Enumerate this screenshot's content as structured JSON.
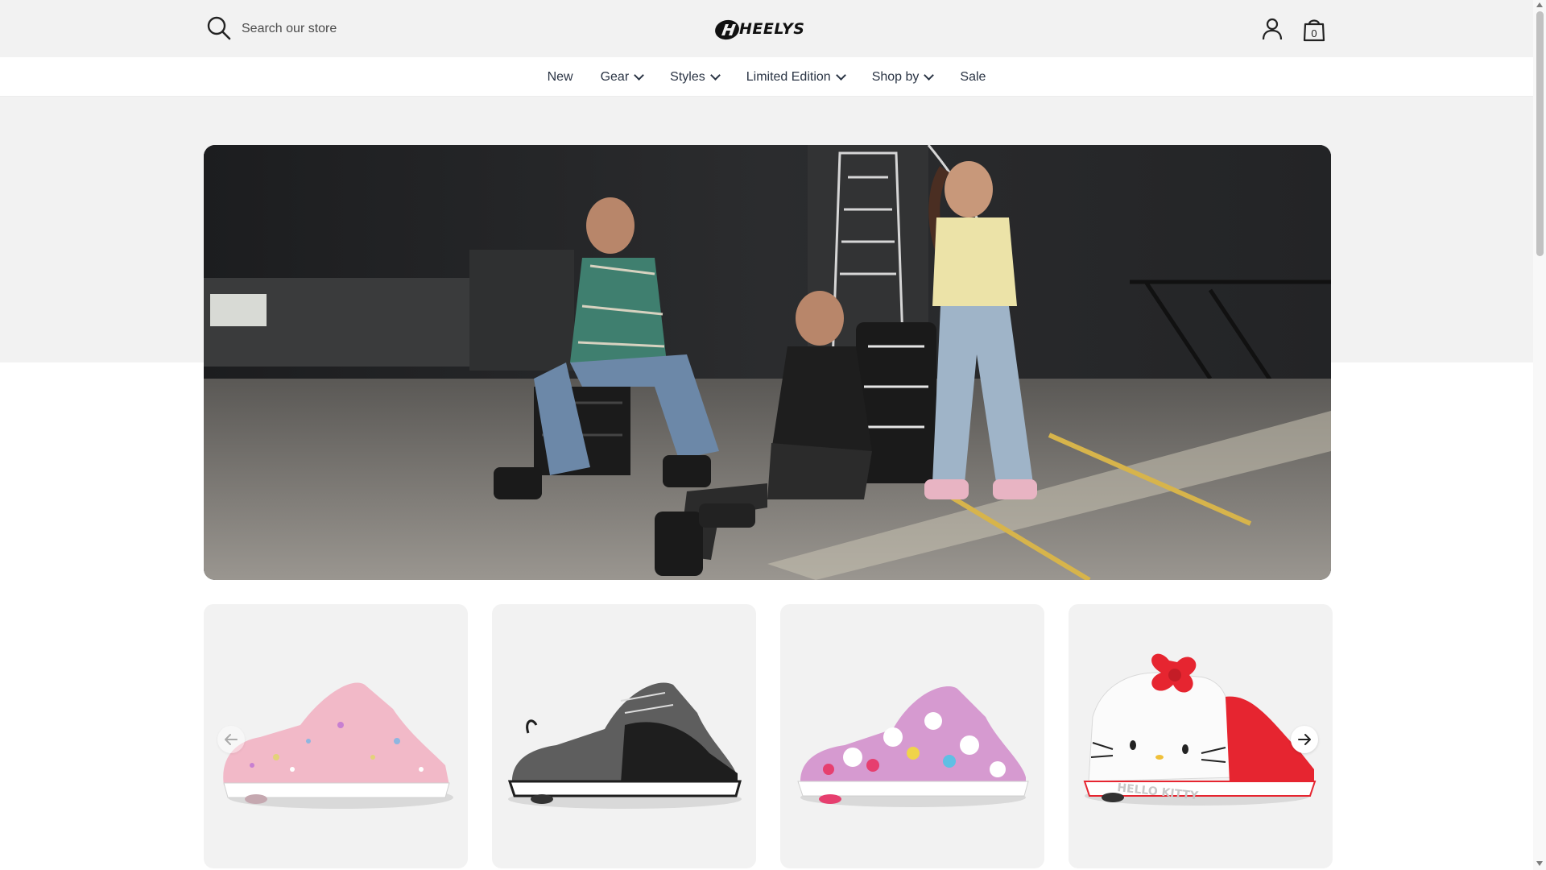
{
  "header": {
    "search_placeholder": "Search our store",
    "logo_text": "HEELYS",
    "cart_count": "0",
    "icons": [
      "search-icon",
      "heelys-logo",
      "account-icon",
      "bag-icon"
    ]
  },
  "nav": {
    "items": [
      {
        "label": "New",
        "has_dropdown": false
      },
      {
        "label": "Gear",
        "has_dropdown": true
      },
      {
        "label": "Styles",
        "has_dropdown": true
      },
      {
        "label": "Limited Edition",
        "has_dropdown": true
      },
      {
        "label": "Shop by",
        "has_dropdown": true
      },
      {
        "label": "Sale",
        "has_dropdown": false
      }
    ]
  },
  "hero": {
    "image": "three-teens-in-heelys-on-parking-lot"
  },
  "products": {
    "cards": [
      {
        "image": "pink-glitter-sneaker"
      },
      {
        "image": "grey-black-sneaker"
      },
      {
        "image": "hello-kitty-print-sneaker"
      },
      {
        "image": "hello-kitty-hightop-sneaker",
        "shoe_text": "HELLO KITTY"
      }
    ],
    "arrows": [
      "arrow-left-icon",
      "arrow-right-icon"
    ]
  },
  "colors": {
    "header_bg": "#f2f2f2",
    "nav_text": "#2a3444",
    "card_bg": "#f2f2f2"
  }
}
